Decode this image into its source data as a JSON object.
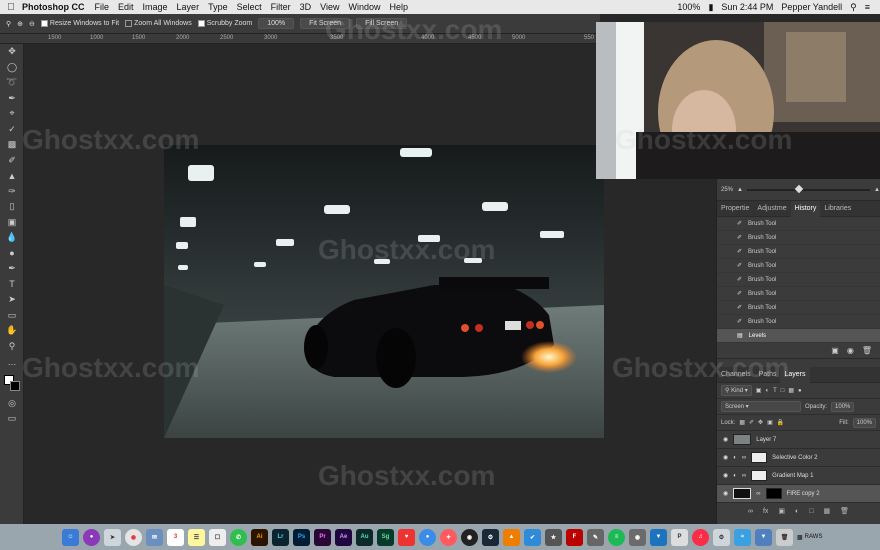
{
  "menubar": {
    "apple": "",
    "app_name": "Photoshop CC",
    "items": [
      "File",
      "Edit",
      "Image",
      "Layer",
      "Type",
      "Select",
      "Filter",
      "3D",
      "View",
      "Window",
      "Help"
    ],
    "battery": "100%",
    "clock": "Sun 2:44 PM",
    "user": "Pepper Yandell"
  },
  "options": {
    "resize_windows": "Resize Windows to Fit",
    "zoom_all": "Zoom All Windows",
    "scrubby": "Scrubby Zoom",
    "zoom_pct": "100%",
    "fit_screen": "Fit Screen",
    "fill_screen": "Fill Screen"
  },
  "ruler": [
    "1500",
    "1000",
    "1500",
    "2000",
    "2500",
    "3000",
    "3500",
    "4000",
    "4500",
    "5000",
    "550"
  ],
  "navigator": {
    "zoom": "25%"
  },
  "history": {
    "tabs": [
      "Propertie",
      "Adjustme",
      "History",
      "Libraries"
    ],
    "active_tab": 2,
    "items": [
      "Brush Tool",
      "Brush Tool",
      "Brush Tool",
      "Brush Tool",
      "Brush Tool",
      "Brush Tool",
      "Brush Tool",
      "Brush Tool",
      "Levels"
    ]
  },
  "layers": {
    "tabs": [
      "Channels",
      "Paths",
      "Layers"
    ],
    "active_tab": 2,
    "kind": "Kind",
    "blend_mode": "Screen",
    "opacity_label": "Opacity:",
    "opacity": "100%",
    "lock_label": "Lock:",
    "fill_label": "Fill:",
    "fill": "100%",
    "items": [
      {
        "name": "Layer 7"
      },
      {
        "name": "Selective Color 2"
      },
      {
        "name": "Gradient Map 1"
      },
      {
        "name": "FIRE copy 2"
      }
    ]
  },
  "watermark": "Ghostxx.com",
  "dock": {
    "icons": [
      "Ai",
      "Lr",
      "Ps",
      "Pr",
      "Ae",
      "Au",
      "Sg"
    ],
    "raws_label": "RAWS"
  }
}
